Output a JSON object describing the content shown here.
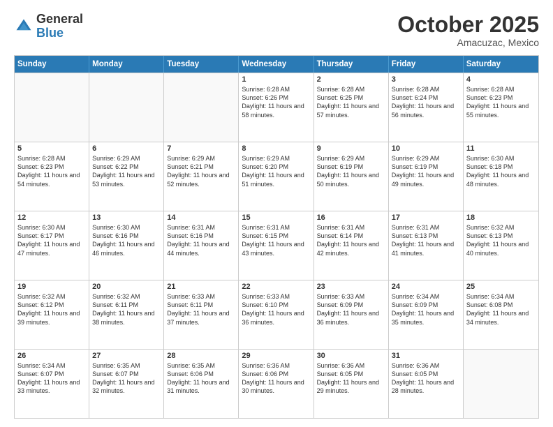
{
  "header": {
    "logo_general": "General",
    "logo_blue": "Blue",
    "month_title": "October 2025",
    "location": "Amacuzac, Mexico"
  },
  "weekdays": [
    "Sunday",
    "Monday",
    "Tuesday",
    "Wednesday",
    "Thursday",
    "Friday",
    "Saturday"
  ],
  "rows": [
    [
      {
        "day": "",
        "empty": true
      },
      {
        "day": "",
        "empty": true
      },
      {
        "day": "",
        "empty": true
      },
      {
        "day": "1",
        "sunrise": "Sunrise: 6:28 AM",
        "sunset": "Sunset: 6:26 PM",
        "daylight": "Daylight: 11 hours and 58 minutes."
      },
      {
        "day": "2",
        "sunrise": "Sunrise: 6:28 AM",
        "sunset": "Sunset: 6:25 PM",
        "daylight": "Daylight: 11 hours and 57 minutes."
      },
      {
        "day": "3",
        "sunrise": "Sunrise: 6:28 AM",
        "sunset": "Sunset: 6:24 PM",
        "daylight": "Daylight: 11 hours and 56 minutes."
      },
      {
        "day": "4",
        "sunrise": "Sunrise: 6:28 AM",
        "sunset": "Sunset: 6:23 PM",
        "daylight": "Daylight: 11 hours and 55 minutes."
      }
    ],
    [
      {
        "day": "5",
        "sunrise": "Sunrise: 6:28 AM",
        "sunset": "Sunset: 6:23 PM",
        "daylight": "Daylight: 11 hours and 54 minutes."
      },
      {
        "day": "6",
        "sunrise": "Sunrise: 6:29 AM",
        "sunset": "Sunset: 6:22 PM",
        "daylight": "Daylight: 11 hours and 53 minutes."
      },
      {
        "day": "7",
        "sunrise": "Sunrise: 6:29 AM",
        "sunset": "Sunset: 6:21 PM",
        "daylight": "Daylight: 11 hours and 52 minutes."
      },
      {
        "day": "8",
        "sunrise": "Sunrise: 6:29 AM",
        "sunset": "Sunset: 6:20 PM",
        "daylight": "Daylight: 11 hours and 51 minutes."
      },
      {
        "day": "9",
        "sunrise": "Sunrise: 6:29 AM",
        "sunset": "Sunset: 6:19 PM",
        "daylight": "Daylight: 11 hours and 50 minutes."
      },
      {
        "day": "10",
        "sunrise": "Sunrise: 6:29 AM",
        "sunset": "Sunset: 6:19 PM",
        "daylight": "Daylight: 11 hours and 49 minutes."
      },
      {
        "day": "11",
        "sunrise": "Sunrise: 6:30 AM",
        "sunset": "Sunset: 6:18 PM",
        "daylight": "Daylight: 11 hours and 48 minutes."
      }
    ],
    [
      {
        "day": "12",
        "sunrise": "Sunrise: 6:30 AM",
        "sunset": "Sunset: 6:17 PM",
        "daylight": "Daylight: 11 hours and 47 minutes."
      },
      {
        "day": "13",
        "sunrise": "Sunrise: 6:30 AM",
        "sunset": "Sunset: 6:16 PM",
        "daylight": "Daylight: 11 hours and 46 minutes."
      },
      {
        "day": "14",
        "sunrise": "Sunrise: 6:31 AM",
        "sunset": "Sunset: 6:16 PM",
        "daylight": "Daylight: 11 hours and 44 minutes."
      },
      {
        "day": "15",
        "sunrise": "Sunrise: 6:31 AM",
        "sunset": "Sunset: 6:15 PM",
        "daylight": "Daylight: 11 hours and 43 minutes."
      },
      {
        "day": "16",
        "sunrise": "Sunrise: 6:31 AM",
        "sunset": "Sunset: 6:14 PM",
        "daylight": "Daylight: 11 hours and 42 minutes."
      },
      {
        "day": "17",
        "sunrise": "Sunrise: 6:31 AM",
        "sunset": "Sunset: 6:13 PM",
        "daylight": "Daylight: 11 hours and 41 minutes."
      },
      {
        "day": "18",
        "sunrise": "Sunrise: 6:32 AM",
        "sunset": "Sunset: 6:13 PM",
        "daylight": "Daylight: 11 hours and 40 minutes."
      }
    ],
    [
      {
        "day": "19",
        "sunrise": "Sunrise: 6:32 AM",
        "sunset": "Sunset: 6:12 PM",
        "daylight": "Daylight: 11 hours and 39 minutes."
      },
      {
        "day": "20",
        "sunrise": "Sunrise: 6:32 AM",
        "sunset": "Sunset: 6:11 PM",
        "daylight": "Daylight: 11 hours and 38 minutes."
      },
      {
        "day": "21",
        "sunrise": "Sunrise: 6:33 AM",
        "sunset": "Sunset: 6:11 PM",
        "daylight": "Daylight: 11 hours and 37 minutes."
      },
      {
        "day": "22",
        "sunrise": "Sunrise: 6:33 AM",
        "sunset": "Sunset: 6:10 PM",
        "daylight": "Daylight: 11 hours and 36 minutes."
      },
      {
        "day": "23",
        "sunrise": "Sunrise: 6:33 AM",
        "sunset": "Sunset: 6:09 PM",
        "daylight": "Daylight: 11 hours and 36 minutes."
      },
      {
        "day": "24",
        "sunrise": "Sunrise: 6:34 AM",
        "sunset": "Sunset: 6:09 PM",
        "daylight": "Daylight: 11 hours and 35 minutes."
      },
      {
        "day": "25",
        "sunrise": "Sunrise: 6:34 AM",
        "sunset": "Sunset: 6:08 PM",
        "daylight": "Daylight: 11 hours and 34 minutes."
      }
    ],
    [
      {
        "day": "26",
        "sunrise": "Sunrise: 6:34 AM",
        "sunset": "Sunset: 6:07 PM",
        "daylight": "Daylight: 11 hours and 33 minutes."
      },
      {
        "day": "27",
        "sunrise": "Sunrise: 6:35 AM",
        "sunset": "Sunset: 6:07 PM",
        "daylight": "Daylight: 11 hours and 32 minutes."
      },
      {
        "day": "28",
        "sunrise": "Sunrise: 6:35 AM",
        "sunset": "Sunset: 6:06 PM",
        "daylight": "Daylight: 11 hours and 31 minutes."
      },
      {
        "day": "29",
        "sunrise": "Sunrise: 6:36 AM",
        "sunset": "Sunset: 6:06 PM",
        "daylight": "Daylight: 11 hours and 30 minutes."
      },
      {
        "day": "30",
        "sunrise": "Sunrise: 6:36 AM",
        "sunset": "Sunset: 6:05 PM",
        "daylight": "Daylight: 11 hours and 29 minutes."
      },
      {
        "day": "31",
        "sunrise": "Sunrise: 6:36 AM",
        "sunset": "Sunset: 6:05 PM",
        "daylight": "Daylight: 11 hours and 28 minutes."
      },
      {
        "day": "",
        "empty": true
      }
    ]
  ]
}
